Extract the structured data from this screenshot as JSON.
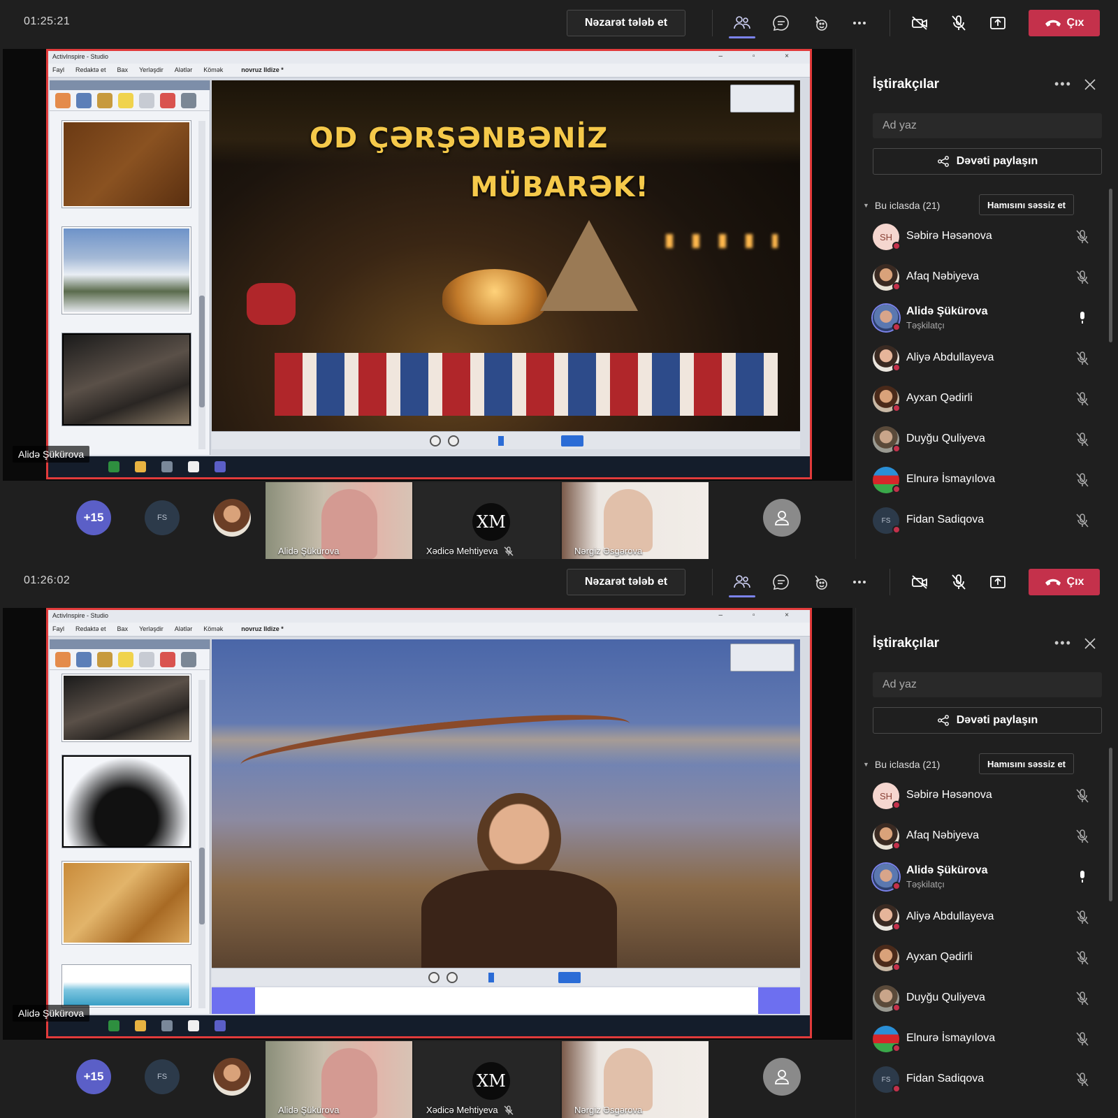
{
  "panels": [
    {
      "timer": "01:25:21",
      "request_control": "Nəzarət tələb et",
      "leave": "Çıx",
      "presenter": "Alidə Şükürova",
      "video_text_line1": "OD ÇƏRŞƏNBƏNİZ",
      "video_text_line2": "MÜBARƏK!"
    },
    {
      "timer": "01:26:02",
      "request_control": "Nəzarət tələb et",
      "leave": "Çıx",
      "presenter": "Alidə Şükürova"
    }
  ],
  "shared_window": {
    "title": "ActivInspire - Studio",
    "menu": [
      "Fayl",
      "Redaktə et",
      "Bax",
      "Yerləşdir",
      "Alətlər",
      "Kömək"
    ],
    "doc_tab": "novruz Ildize *"
  },
  "strip": {
    "overflow": "+15",
    "fs_initials": "FS",
    "xm_initials": "XM",
    "tiles": [
      "Alidə Şükürova",
      "Xədicə Mehtiyeva",
      "Nərgiz Əsgərova"
    ]
  },
  "side": {
    "title": "İştirakçılar",
    "search_placeholder": "Ad yaz",
    "invite": "Dəvəti paylaşın",
    "section": "Bu iclasda (21)",
    "mute_all": "Hamısını səssiz et",
    "organizer_role": "Təşkilatçı",
    "participants": [
      {
        "name": "Səbirə Həsənova",
        "initials": "SH",
        "muted": true
      },
      {
        "name": "Afaq Nəbiyeva",
        "initials": "",
        "muted": true
      },
      {
        "name": "Alidə Şükürova",
        "initials": "",
        "muted": false,
        "organizer": true
      },
      {
        "name": "Aliyə Abdullayeva",
        "initials": "",
        "muted": true
      },
      {
        "name": "Ayxan Qədirli",
        "initials": "",
        "muted": true
      },
      {
        "name": "Duyğu Quliyeva",
        "initials": "",
        "muted": true
      },
      {
        "name": "Elnurə İsmayılova",
        "initials": "",
        "muted": true
      },
      {
        "name": "Fidan Sadiqova",
        "initials": "FS",
        "muted": true
      }
    ]
  },
  "colors": {
    "leave": "#c4314b",
    "accent": "#5b5fc7",
    "share_border": "#e23b3b"
  }
}
